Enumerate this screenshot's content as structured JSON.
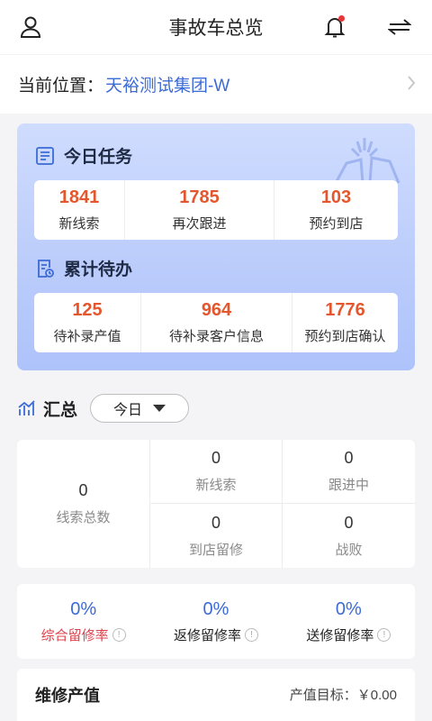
{
  "header": {
    "title": "事故车总览"
  },
  "location": {
    "label": "当前位置：",
    "value": "天裕测试集团-W"
  },
  "today_tasks": {
    "title": "今日任务",
    "items": [
      {
        "value": "1841",
        "label": "新线索"
      },
      {
        "value": "1785",
        "label": "再次跟进"
      },
      {
        "value": "103",
        "label": "预约到店"
      }
    ]
  },
  "pending": {
    "title": "累计待办",
    "items": [
      {
        "value": "125",
        "label": "待补录产值"
      },
      {
        "value": "964",
        "label": "待补录客户信息"
      },
      {
        "value": "1776",
        "label": "预约到店确认"
      }
    ]
  },
  "summary": {
    "title": "汇总",
    "period": "今日",
    "total": {
      "value": "0",
      "label": "线索总数"
    },
    "cells": [
      {
        "value": "0",
        "label": "新线索"
      },
      {
        "value": "0",
        "label": "跟进中"
      },
      {
        "value": "0",
        "label": "到店留修"
      },
      {
        "value": "0",
        "label": "战败"
      }
    ]
  },
  "rates": [
    {
      "value": "0%",
      "label": "综合留修率"
    },
    {
      "value": "0%",
      "label": "返修留修率"
    },
    {
      "value": "0%",
      "label": "送修留修率"
    }
  ],
  "repair": {
    "title": "维修产值",
    "target": "产值目标：￥0.00"
  },
  "colors": {
    "accent_blue": "#3b6bd6",
    "number_orange": "#e4572e",
    "alert_red": "#e0404a"
  }
}
